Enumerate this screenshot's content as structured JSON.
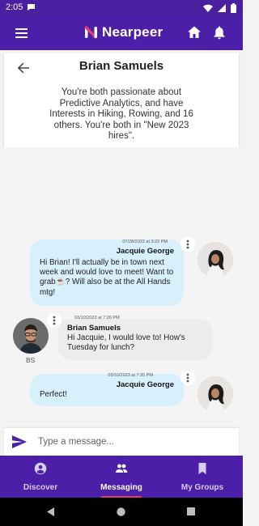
{
  "status_bar": {
    "time": "2:05"
  },
  "app": {
    "name": "Nearpeer",
    "brand_color": "#4b1fa8",
    "logo_accent": "#e23a6a"
  },
  "header": {
    "name": "Brian Samuels",
    "blurb": "You're both passionate about Predictive Analytics, and have Interests in Hiking, Rowing, and 16 others. You're both in \"New 2023 hires\"."
  },
  "messages": [
    {
      "direction": "outgoing",
      "timestamp": "07/28/2022 at 3:22 PM",
      "sender": "Jacquie George",
      "lines": [
        "Hi Brian! I'll actually be in town next",
        "week and would love to meet! Want to",
        "grab☕? Will also be at the All Hands",
        "mtg!"
      ]
    },
    {
      "direction": "incoming",
      "timestamp": "03/10/2023 at 7:26 PM",
      "sender": "Brian Samuels",
      "avatar_label": "BS",
      "lines": [
        "Hi Jacquie, I would love to! How's",
        "Tuesday for lunch?"
      ]
    },
    {
      "direction": "outgoing",
      "timestamp": "03/10/2023 at 7:35 PM",
      "sender": "Jacquie George",
      "lines": [
        "Perfect!"
      ]
    }
  ],
  "composer": {
    "placeholder": "Type a message...",
    "value": ""
  },
  "bottom_nav": [
    {
      "label": "Discover",
      "icon": "account-circle-icon",
      "active": false
    },
    {
      "label": "Messaging",
      "icon": "people-icon",
      "active": true
    },
    {
      "label": "My Groups",
      "icon": "bookmark-icon",
      "active": false
    }
  ]
}
